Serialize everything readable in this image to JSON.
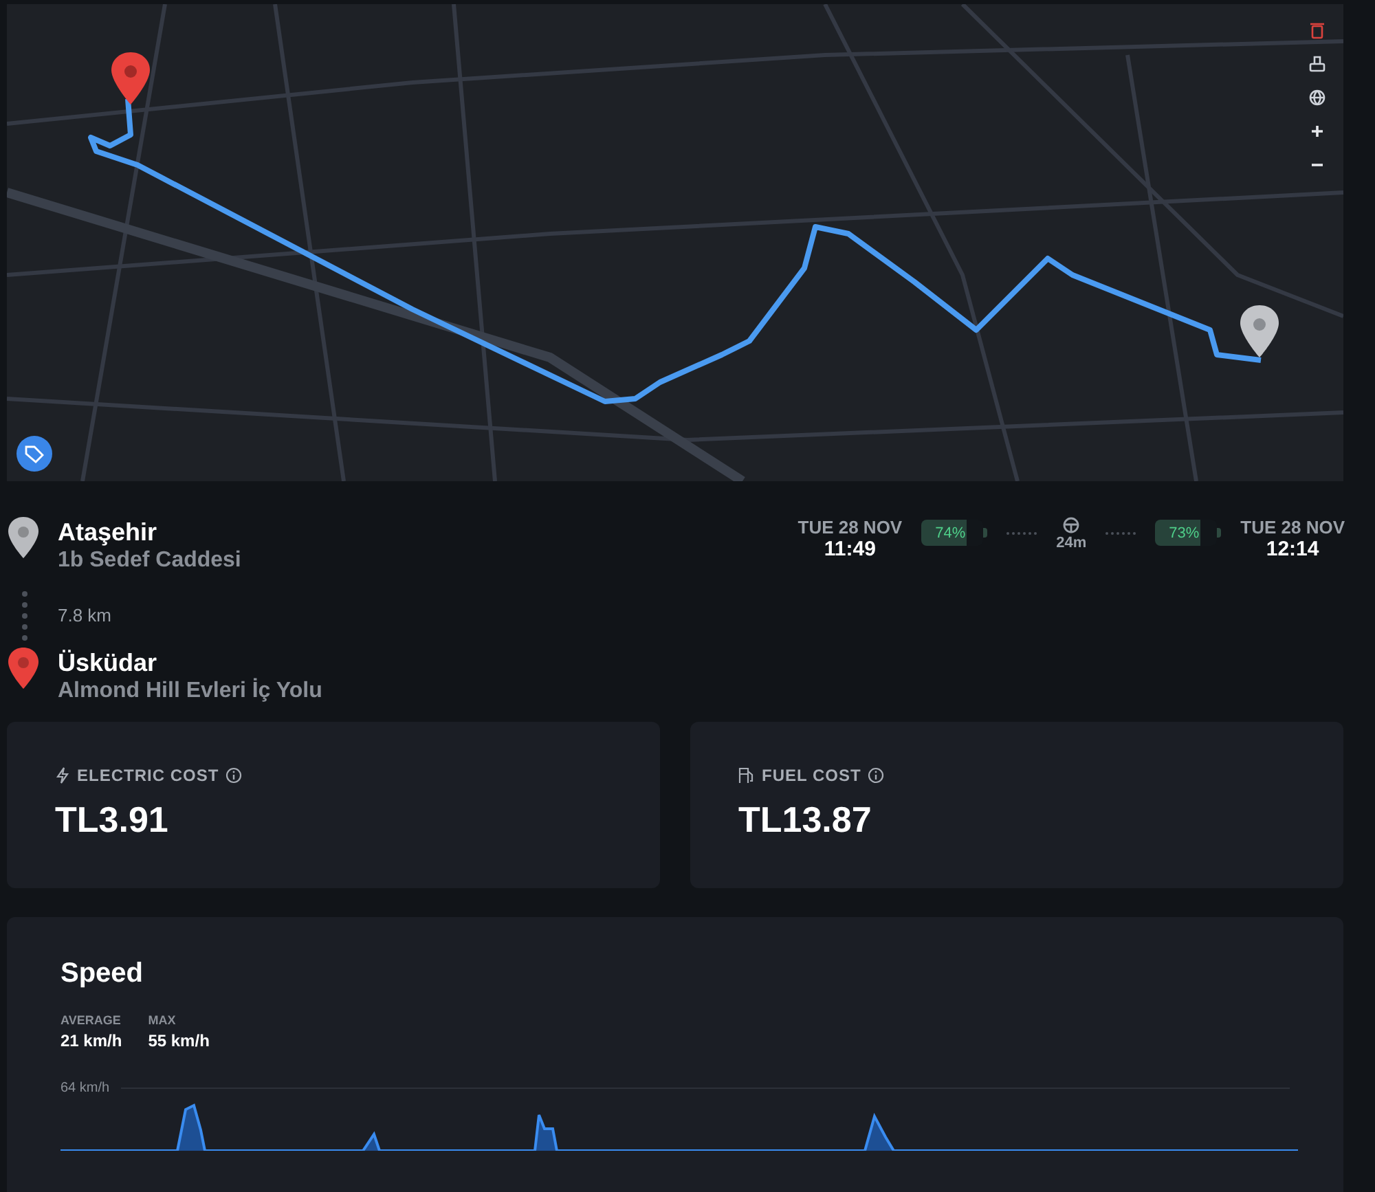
{
  "trip": {
    "start": {
      "place": "Ataşehir",
      "address": "1b Sedef Caddesi"
    },
    "distance": "7.8 km",
    "end": {
      "place": "Üsküdar",
      "address": "Almond Hill Evleri İç Yolu"
    },
    "departure": {
      "date": "TUE 28 NOV",
      "time": "11:49",
      "battery": {
        "label": "74%",
        "level": 0.74
      }
    },
    "duration": "24m",
    "arrival": {
      "date": "TUE 28 NOV",
      "time": "12:14",
      "battery": {
        "label": "73%",
        "level": 0.73
      }
    }
  },
  "costs": [
    {
      "kind": "electric",
      "label": "ELECTRIC COST",
      "value": "TL3.91"
    },
    {
      "kind": "fuel",
      "label": "FUEL COST",
      "value": "TL13.87"
    }
  ],
  "speed": {
    "title": "Speed",
    "stats": [
      {
        "label": "AVERAGE",
        "value": "21 km/h"
      },
      {
        "label": "MAX",
        "value": "55 km/h"
      }
    ],
    "axis_label": "64 km/h"
  }
}
